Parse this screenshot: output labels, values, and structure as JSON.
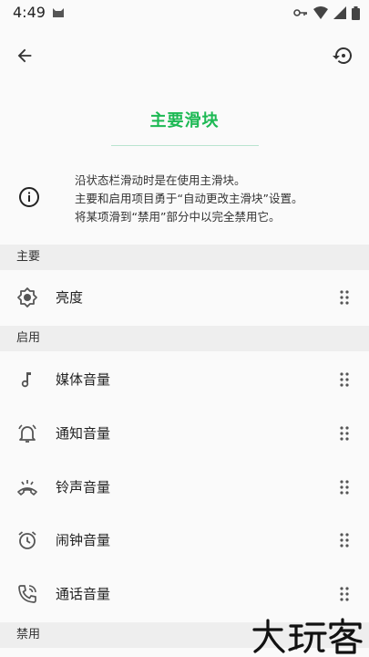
{
  "status_bar": {
    "time": "4:49",
    "icons": [
      "cat-icon",
      "vpn-key-icon",
      "wifi-icon",
      "signal-icon",
      "battery-icon"
    ]
  },
  "toolbar": {
    "back_icon": "arrow-left-icon",
    "reset_icon": "restore-icon"
  },
  "title": "主要滑块",
  "info": {
    "icon": "info-icon",
    "lines": [
      "沿状态栏滑动时是在使用主滑块。",
      "主要和启用项目勇于“自动更改主滑块”设置。",
      "将某项滑到“禁用”部分中以完全禁用它。"
    ]
  },
  "sections": {
    "primary": {
      "header": "主要",
      "items": [
        {
          "label": "亮度",
          "icon": "brightness-icon"
        }
      ]
    },
    "enabled": {
      "header": "启用",
      "items": [
        {
          "label": "媒体音量",
          "icon": "music-note-icon"
        },
        {
          "label": "通知音量",
          "icon": "notification-bell-icon"
        },
        {
          "label": "铃声音量",
          "icon": "ringer-icon"
        },
        {
          "label": "闹钟音量",
          "icon": "alarm-icon"
        },
        {
          "label": "通话音量",
          "icon": "phone-in-call-icon"
        }
      ]
    },
    "disabled": {
      "header": "禁用"
    }
  },
  "watermark": "大玩客",
  "colors": {
    "accent": "#1db954",
    "background": "#fafafa",
    "section_header": "#eeeeee",
    "icon_gray": "#555555"
  }
}
